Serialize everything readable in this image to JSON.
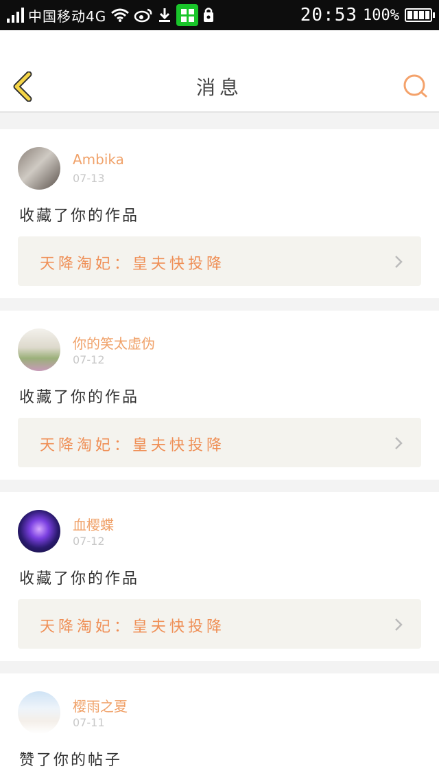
{
  "status_bar": {
    "carrier": "中国移动4G",
    "time": "20:53",
    "battery": "100%"
  },
  "header": {
    "title": "消息"
  },
  "colors": {
    "accent": "#f0a26a",
    "back_icon": "#f5d547",
    "search_icon": "#f4a26b",
    "work_title": "#ef8f56"
  },
  "messages": [
    {
      "user": "Ambika",
      "date": "07-13",
      "action": "收藏了你的作品",
      "work": "天降淘妃：皇夫快投降"
    },
    {
      "user": "你的笑太虚伪",
      "date": "07-12",
      "action": "收藏了你的作品",
      "work": "天降淘妃：皇夫快投降"
    },
    {
      "user": "血樱蝶",
      "date": "07-12",
      "action": "收藏了你的作品",
      "work": "天降淘妃：皇夫快投降"
    },
    {
      "user": "樱雨之夏",
      "date": "07-11",
      "action": "赞了你的帖子"
    }
  ]
}
